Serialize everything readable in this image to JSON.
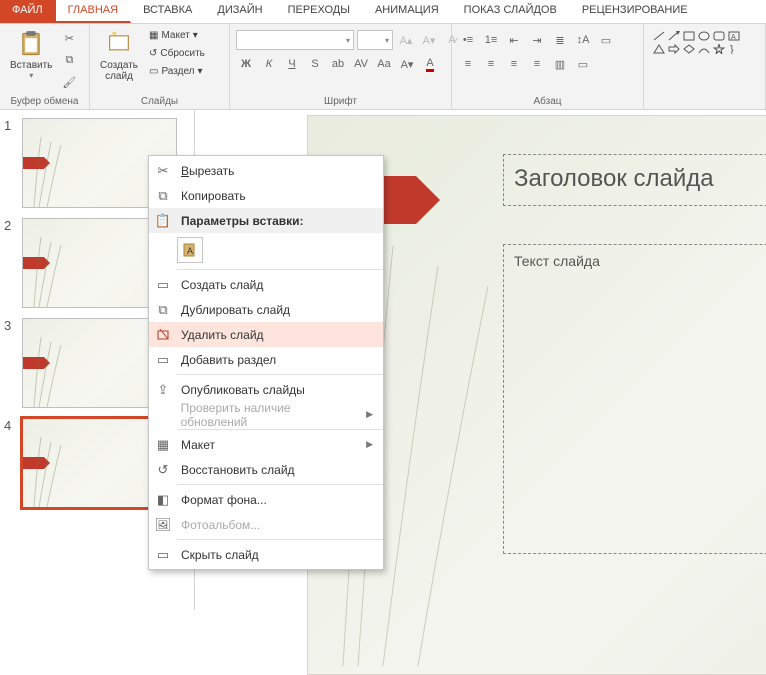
{
  "tabs": {
    "file": "ФАЙЛ",
    "home": "ГЛАВНАЯ",
    "insert": "ВСТАВКА",
    "design": "ДИЗАЙН",
    "transitions": "ПЕРЕХОДЫ",
    "animation": "АНИМАЦИЯ",
    "slideshow": "ПОКАЗ СЛАЙДОВ",
    "review": "РЕЦЕНЗИРОВАНИЕ"
  },
  "ribbon": {
    "clipboard": {
      "label": "Буфер обмена",
      "paste": "Вставить"
    },
    "slides": {
      "label": "Слайды",
      "new_slide": "Создать\nслайд",
      "layout": "Макет",
      "reset": "Сбросить",
      "section": "Раздел"
    },
    "font": {
      "label": "Шрифт",
      "family": "",
      "size": ""
    },
    "paragraph": {
      "label": "Абзац"
    }
  },
  "thumbnails": [
    {
      "num": "1"
    },
    {
      "num": "2"
    },
    {
      "num": "3"
    },
    {
      "num": "4"
    }
  ],
  "slide": {
    "title_placeholder": "Заголовок слайда",
    "body_placeholder": "Текст слайда"
  },
  "context_menu": {
    "cut": "Вырезать",
    "copy": "Копировать",
    "paste_options": "Параметры вставки:",
    "new_slide": "Создать слайд",
    "duplicate": "Дублировать слайд",
    "delete": "Удалить слайд",
    "add_section": "Добавить раздел",
    "publish": "Опубликовать слайды",
    "check_updates": "Проверить наличие обновлений",
    "layout": "Макет",
    "restore": "Восстановить слайд",
    "background": "Формат фона...",
    "photoalbum": "Фотоальбом...",
    "hide": "Скрыть слайд"
  }
}
